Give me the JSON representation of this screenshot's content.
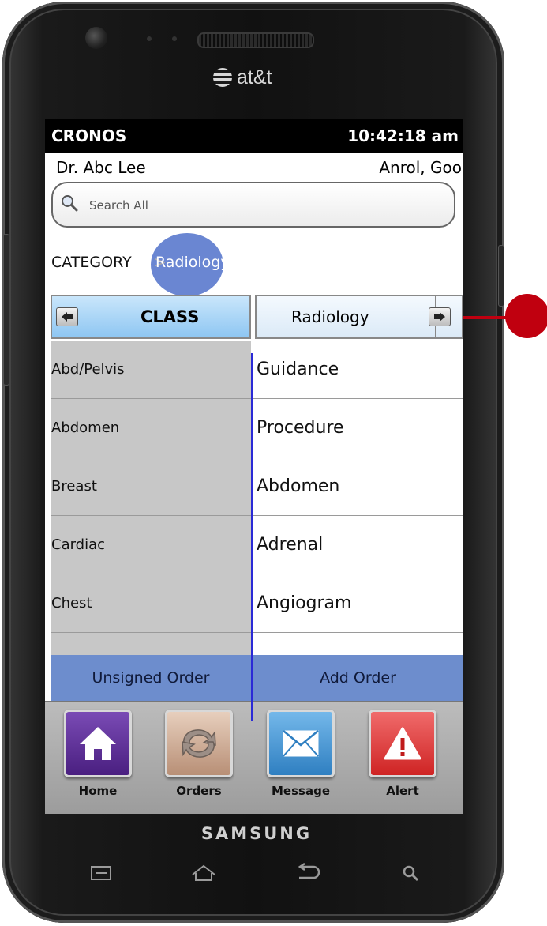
{
  "device": {
    "carrier": "at&t",
    "brand": "SAMSUNG"
  },
  "statusbar": {
    "app_name": "CRONOS",
    "time": "10:42:18 am"
  },
  "header": {
    "doctor": "Dr. Abc Lee",
    "patient": "Anrol, Goo"
  },
  "search": {
    "placeholder": "Search All"
  },
  "breadcrumb": {
    "root": "CATEGORY",
    "separator": ">",
    "current": "Radiology"
  },
  "column_headers": {
    "left": "CLASS",
    "right": "Radiology"
  },
  "class_list": [
    "Abd/Pelvis",
    "Abdomen",
    "Breast",
    "Cardiac",
    "Chest"
  ],
  "item_list": [
    "Guidance",
    "Procedure",
    "Abdomen",
    "Adrenal",
    "Angiogram"
  ],
  "actions": {
    "unsigned_order": "Unsigned Order",
    "add_order": "Add Order"
  },
  "dock": [
    {
      "label": "Home",
      "icon": "home-icon",
      "color": "#5a2d91"
    },
    {
      "label": "Orders",
      "icon": "orders-icon",
      "color": "#c9a58c"
    },
    {
      "label": "Message",
      "icon": "message-icon",
      "color": "#3b8fd0"
    },
    {
      "label": "Alert",
      "icon": "alert-icon",
      "color": "#d93636"
    }
  ],
  "colors": {
    "accent_blue": "#6d8dcd",
    "divider_blue": "#2a2ad6",
    "annotation_red": "#c0000f"
  }
}
